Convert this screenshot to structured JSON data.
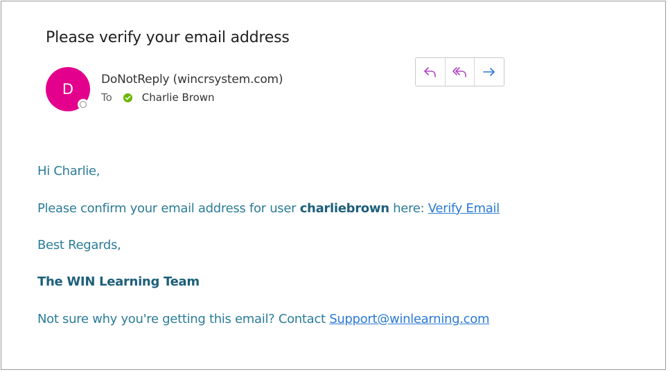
{
  "email": {
    "subject": "Please verify your email address",
    "sender_initial": "D",
    "sender": "DoNotReply (wincrsystem.com)",
    "to_label": "To",
    "recipient": "Charlie Brown",
    "avatar_color": "#e3008c",
    "verified_color": "#6bb700"
  },
  "actions": {
    "reply_icon": "reply-icon",
    "reply_all_icon": "reply-all-icon",
    "forward_icon": "forward-icon"
  },
  "body": {
    "greeting": "Hi Charlie,",
    "confirm_prefix": "Please confirm your email address for user ",
    "username": "charliebrown",
    "confirm_middle": " here: ",
    "verify_link": "Verify Email",
    "regards": "Best Regards,",
    "team": "The WIN Learning Team",
    "notsure_prefix": "Not sure why you're getting this email? Contact ",
    "support_link": "Support@winlearning.com"
  }
}
